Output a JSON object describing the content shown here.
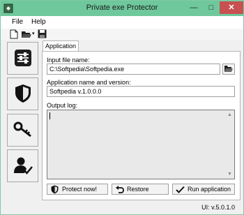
{
  "window": {
    "title": "Private exe Protector"
  },
  "menu": {
    "file": "File",
    "help": "Help"
  },
  "toolbar": {
    "icons": [
      "new-file-icon",
      "open-folder-icon",
      "save-icon"
    ]
  },
  "sidebar": {
    "items": [
      "settings",
      "protection",
      "keys",
      "user"
    ]
  },
  "tab": {
    "label": "Application"
  },
  "form": {
    "input_label": "Input file name:",
    "input_value": "C:\\Softpedia\\Softpedia.exe",
    "name_label": "Application name and version:",
    "name_value": "Softpedia v.1.0.0.0",
    "log_label": "Output log:"
  },
  "actions": {
    "protect": "Protect now!",
    "restore": "Restore",
    "run": "Run application"
  },
  "status": {
    "version": "UI: v.5.0.1.0"
  },
  "colors": {
    "titlebar": "#6fc89c",
    "close": "#c75050"
  }
}
